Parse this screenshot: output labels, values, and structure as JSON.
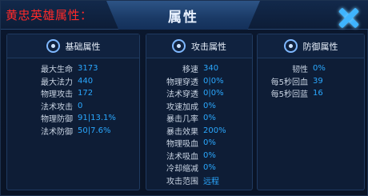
{
  "caption": "黄忠英雄属性：",
  "title": "属性",
  "columns": [
    {
      "header": "基础属性",
      "icon": "gear-icon",
      "rows": [
        {
          "label": "最大生命",
          "value": "3173"
        },
        {
          "label": "最大法力",
          "value": "440"
        },
        {
          "label": "物理攻击",
          "value": "172"
        },
        {
          "label": "法术攻击",
          "value": "0"
        },
        {
          "label": "物理防御",
          "value": "91|13.1%"
        },
        {
          "label": "法术防御",
          "value": "50|7.6%"
        }
      ]
    },
    {
      "header": "攻击属性",
      "icon": "sword-icon",
      "rows": [
        {
          "label": "移速",
          "value": "340"
        },
        {
          "label": "物理穿透",
          "value": "0|0%"
        },
        {
          "label": "法术穿透",
          "value": "0|0%"
        },
        {
          "label": "攻速加成",
          "value": "0%"
        },
        {
          "label": "暴击几率",
          "value": "0%"
        },
        {
          "label": "暴击效果",
          "value": "200%"
        },
        {
          "label": "物理吸血",
          "value": "0%"
        },
        {
          "label": "法术吸血",
          "value": "0%"
        },
        {
          "label": "冷却缩减",
          "value": "0%"
        },
        {
          "label": "攻击范围",
          "value": "远程"
        }
      ]
    },
    {
      "header": "防御属性",
      "icon": "shield-icon",
      "rows": [
        {
          "label": "韧性",
          "value": "0%"
        },
        {
          "label": "每5秒回血",
          "value": "39"
        },
        {
          "label": "每5秒回蓝",
          "value": "16"
        }
      ]
    }
  ],
  "colors": {
    "value": "#2aa8ff",
    "caption": "#ff2a2a",
    "close": "#3fb4ff"
  }
}
